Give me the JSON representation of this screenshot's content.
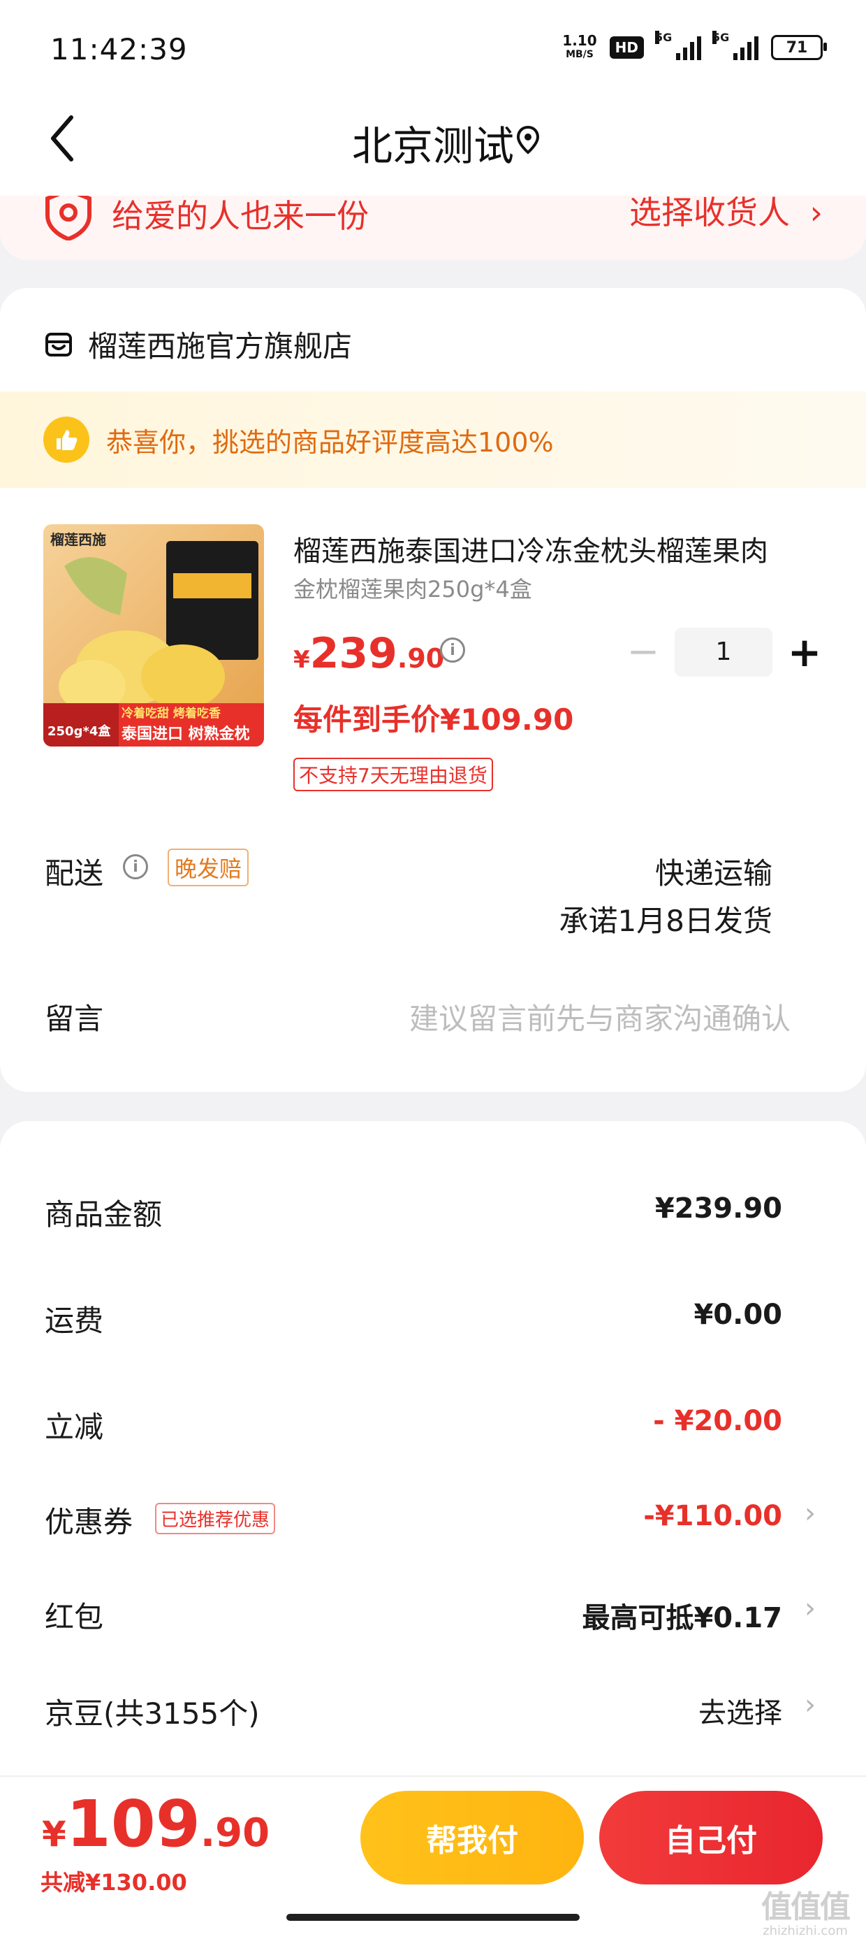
{
  "status_bar": {
    "time": "11:42:39",
    "net_speed_value": "1.10",
    "net_speed_unit": "MB/S",
    "hd_label": "HD",
    "signal1_label": "5G",
    "signal2_label": "5G",
    "battery": "71"
  },
  "header": {
    "title": "北京测试",
    "back_icon": "chevron-left-icon",
    "location_icon": "location-pin-icon"
  },
  "banner": {
    "left_text": "给爱的人也来一份",
    "right_text": "选择收货人",
    "right_chevron": "›"
  },
  "shop": {
    "name": "榴莲西施官方旗舰店",
    "rating_text": "恭喜你，挑选的商品好评度高达100%"
  },
  "product": {
    "brand_logo_text": "榴莲西施",
    "image_badge_text": "泰国进口 树熟金枕",
    "image_spec_text": "250g*4盒",
    "image_tag_text": "冷着吃甜 烤着吃香",
    "title": "榴莲西施泰国进口冷冻金枕头榴莲果肉",
    "spec": "金枕榴莲果肉250g*4盒",
    "price_currency": "¥",
    "price_int": "239",
    "price_dec": ".90",
    "quantity": "1",
    "unit_price": "每件到手价¥109.90",
    "no_return": "不支持7天无理由退货"
  },
  "delivery": {
    "label": "配送",
    "late_badge": "晚发赔",
    "method": "快递运输",
    "date": "承诺1月8日发货"
  },
  "note": {
    "label": "留言",
    "placeholder": "建议留言前先与商家沟通确认"
  },
  "summary": {
    "goods_label": "商品金额",
    "goods_value": "¥239.90",
    "shipping_label": "运费",
    "shipping_value": "¥0.00",
    "discount_label": "立减",
    "discount_value": "- ¥20.00",
    "coupon_label": "优惠券",
    "coupon_badge": "已选推荐优惠",
    "coupon_value": "-¥110.00",
    "redpacket_label": "红包",
    "redpacket_value": "最高可抵¥0.17",
    "beans_label": "京豆(共3155个)",
    "beans_value": "去选择",
    "chevron": "›"
  },
  "bottom": {
    "total_currency": "¥",
    "total_int": "109",
    "total_dec": ".90",
    "total_saved": "共减¥130.00",
    "help_pay": "帮我付",
    "self_pay": "自己付"
  },
  "watermark": {
    "logo_text": "值值值",
    "site": "zhizhizhi.com"
  },
  "colors": {
    "accent_red": "#e8302a",
    "accent_yellow": "#ffc21a",
    "rating_orange": "#e06a10"
  }
}
